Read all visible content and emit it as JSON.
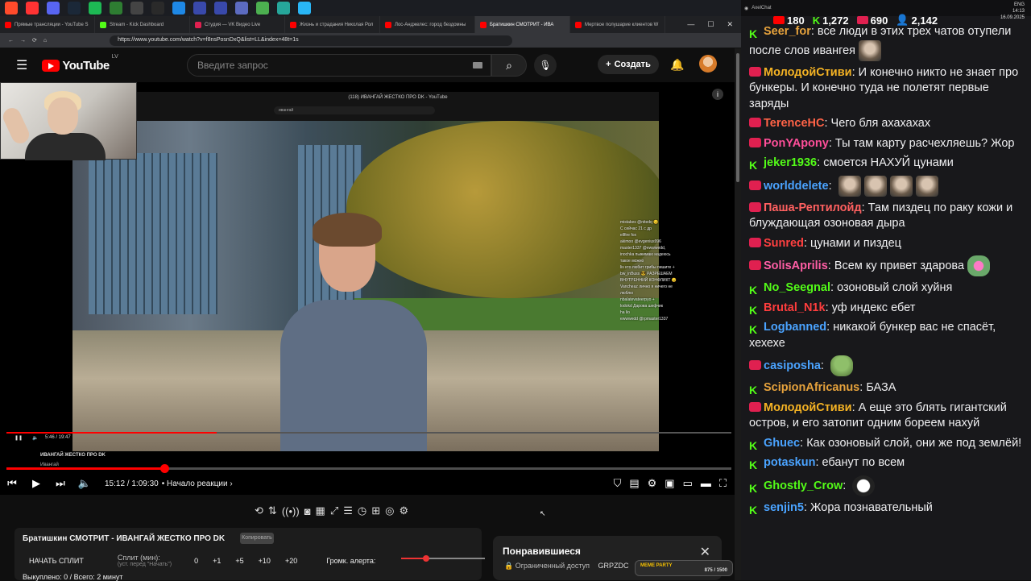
{
  "taskbar": {
    "apps": [
      {
        "name": "browser-app-icon",
        "color": "#ff4b2b"
      },
      {
        "name": "yandex-app-icon",
        "color": "#ff3333"
      },
      {
        "name": "discord-app-icon",
        "color": "#5865f2"
      },
      {
        "name": "steam-app-icon",
        "color": "#1b2838"
      },
      {
        "name": "spotify-app-icon",
        "color": "#1db954"
      },
      {
        "name": "game-app-icon",
        "color": "#2e7d32"
      },
      {
        "name": "obs-app-icon",
        "color": "#444444"
      },
      {
        "name": "xbox-app-icon",
        "color": "#2a2a2a"
      },
      {
        "name": "chat-app-icon",
        "color": "#1e88e5"
      },
      {
        "name": "gallery-app-icon",
        "color": "#3949ab"
      },
      {
        "name": "media-app-icon",
        "color": "#3949ab"
      },
      {
        "name": "twitch-app-icon",
        "color": "#5c6bc0"
      },
      {
        "name": "streamer-app-icon",
        "color": "#4caf50"
      },
      {
        "name": "mod-app-icon",
        "color": "#26a69a"
      },
      {
        "name": "telegram-app-icon",
        "color": "#29b6f6"
      }
    ]
  },
  "tabs": [
    {
      "label": "Прямые трансляции - YouTube S",
      "color": "#ff0000",
      "active": false
    },
    {
      "label": "Stream - Kick Dashboard",
      "color": "#53fc18",
      "active": false
    },
    {
      "label": "Студия — VK Видео Live",
      "color": "#e02050",
      "active": false
    },
    {
      "label": "Жизнь и страдания Николая Рол",
      "color": "#ff0000",
      "active": false
    },
    {
      "label": "Лос-Анджелес: город бездомны",
      "color": "#ff0000",
      "active": false
    },
    {
      "label": "Братишкин СМОТРИТ - ИВА",
      "color": "#ff0000",
      "active": true
    },
    {
      "label": "Мертвое полушарие клиентов W",
      "color": "#ff0000",
      "active": false
    }
  ],
  "browser": {
    "url": "https://www.youtube.com/watch?v=f8nsPosnDxQ&list=LL&index=48t=1s",
    "window_controls": [
      "—",
      "☐",
      "✕"
    ]
  },
  "youtube": {
    "logo_text": "YouTube",
    "region": "LV",
    "search_placeholder": "Введите запрос",
    "create_label": "Создать"
  },
  "inner_player": {
    "title": "(118) ИВАНГАЙ ЖЕСТКО ПРО DK - YouTube",
    "search_text": "ивангай",
    "time": "5:46 / 19:47",
    "progress": 0.29,
    "video_title": "ИВАНГАЙ ЖЕСТКО ПРО DK",
    "channel": "Ивангай",
    "overlay_chat": [
      "mistakes @nitedq 😏",
      "C сейчас 21 с др",
      "ellfire fox",
      "akimoo @evgenius996",
      "master1337 @ewwwedd,",
      "inochka пыжимаю надеюсь",
      "такое можно",
      "lis кто любит грибы пишите +",
      "bw_inBuss 😎 РАЗРЕШАЕМ",
      "ВНУТРЕННИЙ КОНФЛИКТ 😏",
      "Vancheaz лично я ничего не",
      "люблю",
      "nbalatevateerpyo +",
      "lodokd Дарова шефчик",
      "ha lio",
      "ewwwedd @rpmaster1337"
    ]
  },
  "player": {
    "time": "15:12 / 1:09:30",
    "chapter": "Начало реакции",
    "progress": 0.219
  },
  "split": {
    "title": "Братишкин СМОТРИТ - ИВАНГАЙ ЖЕСТКО ПРО DK",
    "copy_label": "Копировать",
    "start_label": "НАЧАТЬ СПЛИТ",
    "minutes_label": "Сплит (мин):",
    "minutes_hint": "(уст. перед \"Начать\")",
    "values": [
      "0",
      "+1",
      "+5",
      "+10",
      "+20"
    ],
    "volume_label": "Громк. алерта:",
    "volume": 0.3,
    "bought_label": "Выкуплено: 0 / Всего: 2 минут"
  },
  "liked": {
    "title": "Понравившиеся",
    "subtitle": "Ограниченный доступ",
    "channel": "GRPZDC",
    "meme_party": "MEME PARTY",
    "meme_progress": "875 / 1500"
  },
  "chat_header": {
    "app": "AxelChat",
    "youtube_viewers": "180",
    "kick_viewers": "1,272",
    "vk_viewers": "690",
    "total_viewers": "2,142",
    "clock": "14:13",
    "date": "16.09.2025",
    "lang": "ENG"
  },
  "chat": [
    {
      "platform": "kick",
      "user": "Seer_for",
      "color": "#e6a23c",
      "text": "все люди в этих трех чатов отупели после слов ивангея",
      "emote": "face"
    },
    {
      "platform": "vk",
      "user": "МолодойСтиви",
      "color": "#f5b324",
      "text": "И конечно никто не знает про бункеры. И конечно туда не полетят первые заряды",
      "emote": ""
    },
    {
      "platform": "vk",
      "user": "TerenceHC",
      "color": "#ff6347",
      "text": "Чего бля ахахахах",
      "emote": ""
    },
    {
      "platform": "vk",
      "user": "PonYApony",
      "color": "#ff4f9a",
      "text": "Ты там карту расчехляешь? Жор",
      "emote": ""
    },
    {
      "platform": "kick",
      "user": "jeker1936",
      "color": "#53fc18",
      "text": "смоется НАХУЙ цунами",
      "emote": ""
    },
    {
      "platform": "vk",
      "user": "worlddelete",
      "color": "#4aa3ff",
      "text": "",
      "emote": "faces4"
    },
    {
      "platform": "vk",
      "user": "Паша-Рептилойд",
      "color": "#ff6060",
      "text": "Там пиздец по раку кожи и блуждающая озоновая дыра",
      "emote": ""
    },
    {
      "platform": "vk",
      "user": "Sunred",
      "color": "#ff4040",
      "text": "цунами и пиздец",
      "emote": ""
    },
    {
      "platform": "vk",
      "user": "SolisAprilis",
      "color": "#ff5ea5",
      "text": "Всем ку привет здарова",
      "emote": "heart"
    },
    {
      "platform": "kick",
      "user": "No_Seegnal",
      "color": "#53fc18",
      "text": "озоновый слой хуйня",
      "emote": ""
    },
    {
      "platform": "kick",
      "user": "Brutal_N1k",
      "color": "#ff3d3d",
      "text": "уф индекс ебет",
      "emote": ""
    },
    {
      "platform": "kick",
      "user": "Logbanned",
      "color": "#4aa3ff",
      "text": "никакой бункер вас не спасёт, хехехе",
      "emote": ""
    },
    {
      "platform": "vk",
      "user": "casiposha",
      "color": "#4aa3ff",
      "text": "",
      "emote": "green"
    },
    {
      "platform": "kick",
      "user": "ScipionAfricanus",
      "color": "#e6a23c",
      "text": "БАЗА",
      "emote": ""
    },
    {
      "platform": "vk",
      "user": "МолодойСтиви",
      "color": "#f5b324",
      "text": "А еще это блять гигантский остров, и его затопит одним бореем нахуй",
      "emote": ""
    },
    {
      "platform": "kick",
      "user": "Ghuec",
      "color": "#4aa3ff",
      "text": "Как озоновый слой, они же под землёй!",
      "emote": ""
    },
    {
      "platform": "kick",
      "user": "potaskun",
      "color": "#4aa3ff",
      "text": "ебанут по всем",
      "emote": ""
    },
    {
      "platform": "kick",
      "user": "Ghostly_Crow",
      "color": "#53fc18",
      "text": "",
      "emote": "white"
    },
    {
      "platform": "kick",
      "user": "senjin5",
      "color": "#4aa3ff",
      "text": "Жора познавательный",
      "emote": ""
    }
  ]
}
